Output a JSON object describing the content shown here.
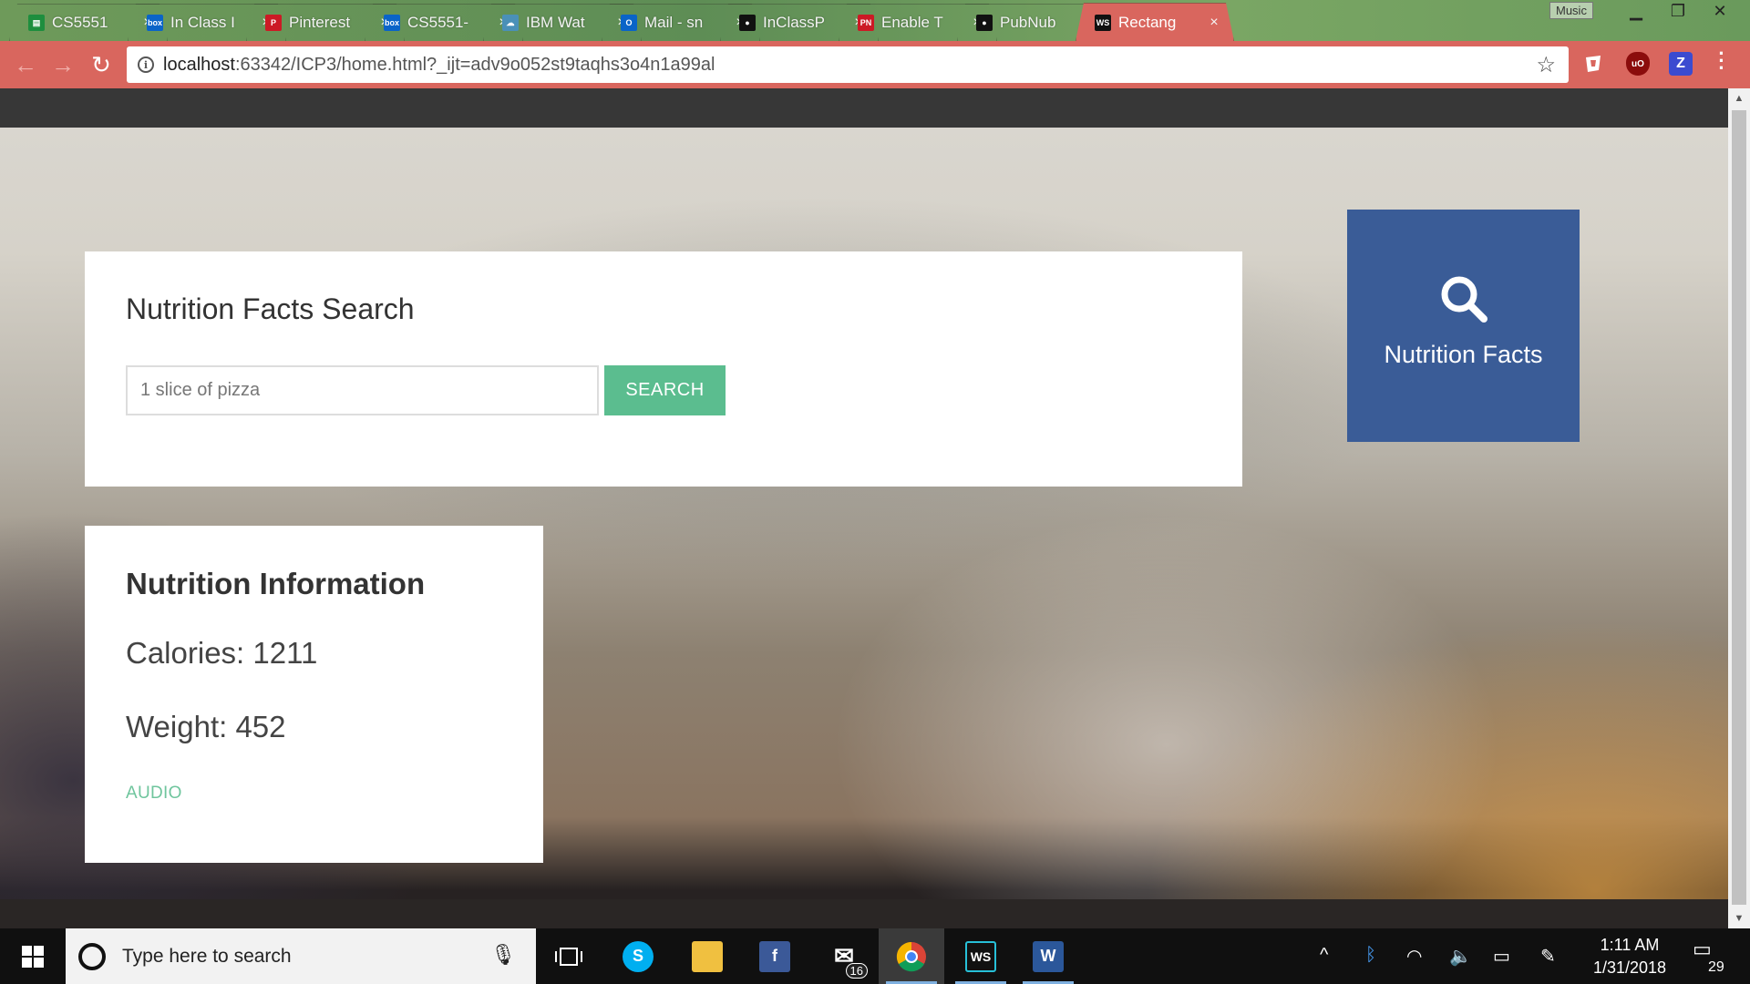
{
  "browser": {
    "tabs": [
      {
        "label": "CS5551",
        "favicon": "sheets-icon",
        "fav_color": "#1e8e3e",
        "fav_glyph": "▤"
      },
      {
        "label": "In Class I",
        "favicon": "box-icon",
        "fav_color": "#0a64c8",
        "fav_glyph": "box"
      },
      {
        "label": "Pinterest",
        "favicon": "pinterest-icon",
        "fav_color": "#cc1a25",
        "fav_glyph": "P"
      },
      {
        "label": "CS5551-",
        "favicon": "box-icon",
        "fav_color": "#0a64c8",
        "fav_glyph": "box"
      },
      {
        "label": "IBM Wat",
        "favicon": "ibm-cloud-icon",
        "fav_color": "#4a90b8",
        "fav_glyph": "☁"
      },
      {
        "label": "Mail - sn",
        "favicon": "outlook-icon",
        "fav_color": "#0a64c8",
        "fav_glyph": "O"
      },
      {
        "label": "InClassP",
        "favicon": "github-icon",
        "fav_color": "#111111",
        "fav_glyph": "●"
      },
      {
        "label": "Enable T",
        "favicon": "pubnub-icon",
        "fav_color": "#cc1a25",
        "fav_glyph": "PN"
      },
      {
        "label": "PubNub",
        "favicon": "github-icon",
        "fav_color": "#111111",
        "fav_glyph": "●"
      },
      {
        "label": "Rectang",
        "favicon": "webstorm-icon",
        "fav_color": "#111111",
        "fav_glyph": "WS",
        "active": true
      }
    ],
    "tab_close_glyph": "×",
    "music_label": "Music",
    "url_host": "localhost",
    "url_path": ":63342/ICP3/home.html?_ijt=adv9o052st9taqhs3o4n1a99al"
  },
  "page": {
    "search_card": {
      "title": "Nutrition Facts Search",
      "input_value": "1 slice of pizza",
      "button_label": "SEARCH"
    },
    "info_card": {
      "title": "Nutrition Information",
      "calories": "Calories: 1211",
      "weight": "Weight: 452",
      "audio_label": "AUDIO"
    },
    "tile": {
      "label": "Nutrition Facts",
      "icon": "search-icon",
      "color": "#3a5c97"
    },
    "accent_color": "#5bbd8f"
  },
  "taskbar": {
    "search_placeholder": "Type here to search",
    "mail_badge": "16",
    "time": "1:11 AM",
    "date": "1/31/2018",
    "notification_count": "29"
  }
}
